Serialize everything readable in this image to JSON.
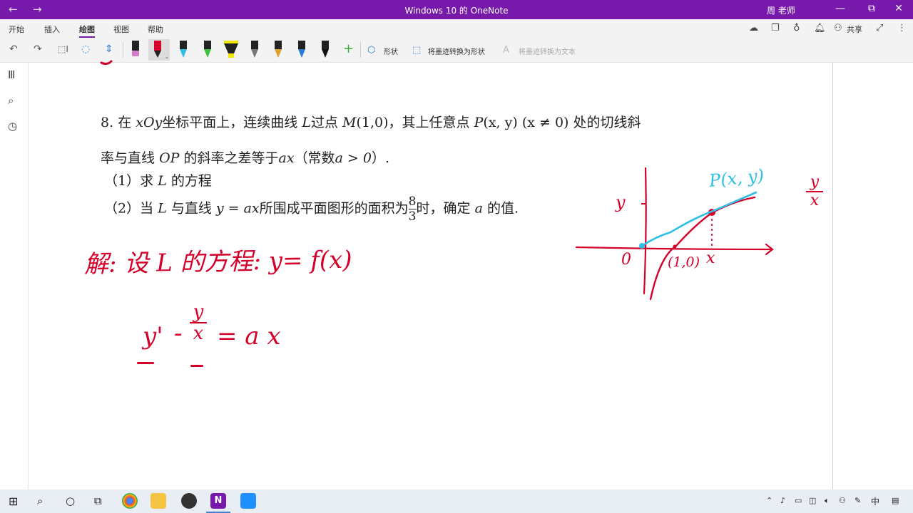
{
  "titlebar": {
    "back": "←",
    "forward": "→",
    "title": "Windows 10 的 OneNote",
    "user": "周 老师",
    "minimize": "—",
    "restore": "⧉",
    "close": "✕"
  },
  "menu": {
    "tabs": [
      "开始",
      "插入",
      "绘图",
      "视图",
      "帮助"
    ],
    "active": "绘图",
    "share": "共享"
  },
  "toolbar": {
    "shapes": "形状",
    "ink_to_shape": "将墨迹转换为形状",
    "ink_to_text": "将墨迹转换为文本"
  },
  "problem": {
    "number": "8.",
    "line1_a": "在",
    "xOy": "xOy",
    "line1_b": "坐标平面上，连续曲线",
    "L": "L",
    "line1_c": "过点",
    "M": "M",
    "M_coord": "(1,0)",
    "line1_d": "，其上任意点",
    "P": "P",
    "P_coord": "(x, y)",
    "cond": "(x ≠ 0)",
    "line1_e": "处的切线斜",
    "line2_a": "率与直线",
    "OP": "OP",
    "line2_b": "的斜率之差等于",
    "ax": "ax",
    "line2_c": "（常数",
    "a_cond": "a > 0",
    "line2_d": "）.",
    "part1_a": "（1）求",
    "part1_b": "的方程",
    "part2_a": "（2）当",
    "part2_b": "与直线",
    "line_eq": "y = ax",
    "part2_c": "所围成平面图形的面积为",
    "frac_num": "8",
    "frac_den": "3",
    "part2_d": "时，确定",
    "a": "a",
    "part2_e": "的值."
  },
  "handwriting": {
    "solution": "解: 设 L 的方程: y= f(x)",
    "equation": "y' - y/x = a x",
    "graph_label_y": "y",
    "graph_label_origin": "0",
    "graph_label_point": "(1,0)",
    "graph_label_x": "x",
    "graph_label_P": "P(x, y)",
    "margin_note_num": "y",
    "margin_note_den": "x"
  },
  "colors": {
    "accent": "#7719aa",
    "ink_red": "#d4002a",
    "ink_blue": "#2fbfe6"
  },
  "taskbar": {
    "input_method": "中"
  }
}
